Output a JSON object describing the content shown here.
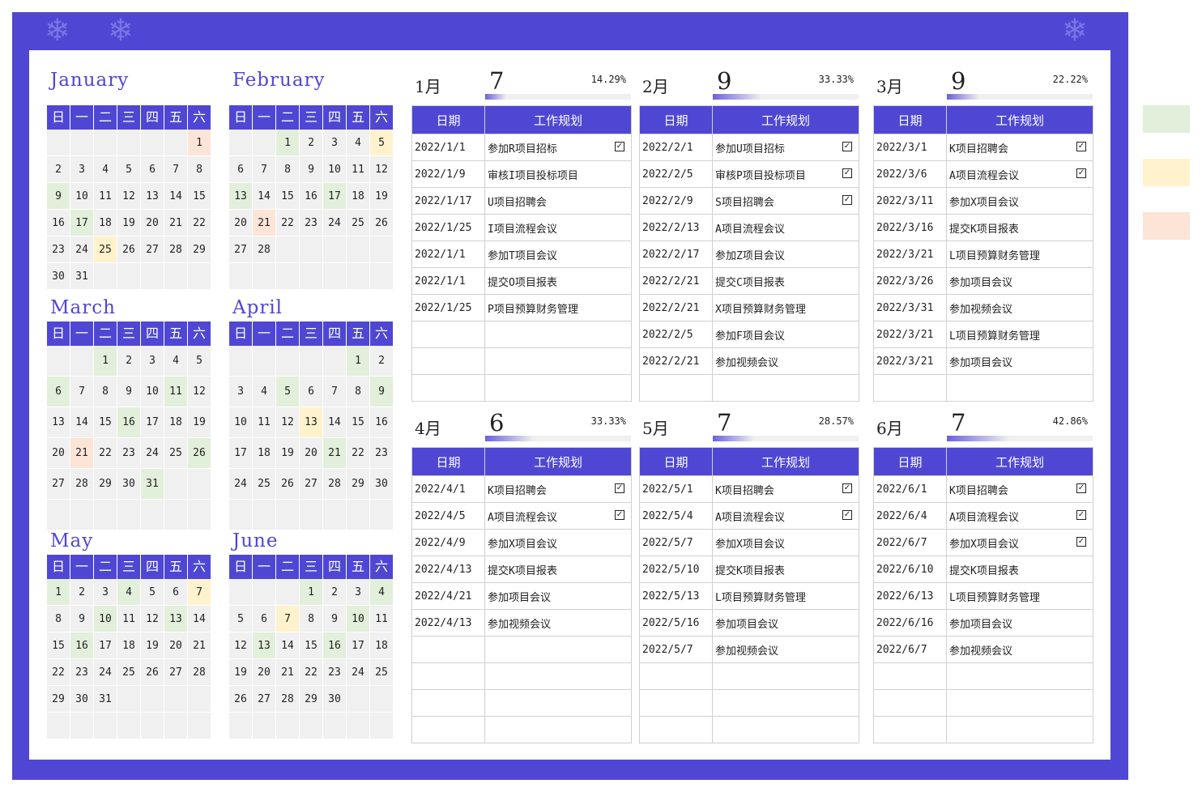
{
  "weekday_labels": [
    "日",
    "一",
    "二",
    "三",
    "四",
    "五",
    "六"
  ],
  "plan_headers": {
    "date": "日期",
    "task": "工作规划"
  },
  "colors": {
    "accent": "#4f47d4",
    "green": "#e2efda",
    "yellow": "#fff2cc",
    "orange": "#fce4d6"
  },
  "calendars": [
    {
      "name": "January",
      "start": 6,
      "days": 31,
      "marks": {
        "1": "o",
        "9": "g",
        "17": "g",
        "25": "y"
      }
    },
    {
      "name": "February",
      "start": 2,
      "days": 28,
      "marks": {
        "1": "g",
        "5": "y",
        "13": "g",
        "17": "g",
        "21": "o"
      }
    },
    {
      "name": "March",
      "start": 2,
      "days": 31,
      "marks": {
        "1": "g",
        "6": "g",
        "11": "g",
        "16": "g",
        "21": "o",
        "26": "g",
        "31": "g"
      }
    },
    {
      "name": "April",
      "start": 5,
      "days": 30,
      "marks": {
        "1": "g",
        "5": "g",
        "9": "g",
        "13": "y",
        "21": "g"
      }
    },
    {
      "name": "May",
      "start": 0,
      "days": 31,
      "marks": {
        "1": "g",
        "4": "g",
        "7": "y",
        "10": "g",
        "13": "g",
        "16": "g"
      }
    },
    {
      "name": "June",
      "start": 3,
      "days": 30,
      "marks": {
        "1": "g",
        "4": "g",
        "7": "y",
        "10": "g",
        "13": "g",
        "16": "g"
      }
    }
  ],
  "plans": [
    {
      "title": "1月",
      "count": "7",
      "percent": "14.29%",
      "progress": 0.1429,
      "rows": [
        {
          "date": "2022/1/1",
          "task": "参加R项目招标",
          "done": true
        },
        {
          "date": "2022/1/9",
          "task": "审核I项目投标项目",
          "done": false
        },
        {
          "date": "2022/1/17",
          "task": "U项目招聘会",
          "done": false
        },
        {
          "date": "2022/1/25",
          "task": "I项目流程会议",
          "done": false
        },
        {
          "date": "2022/1/1",
          "task": "参加T项目会议",
          "done": false
        },
        {
          "date": "2022/1/1",
          "task": "提交O项目报表",
          "done": false
        },
        {
          "date": "2022/1/25",
          "task": "P项目预算财务管理",
          "done": false
        }
      ]
    },
    {
      "title": "2月",
      "count": "9",
      "percent": "33.33%",
      "progress": 0.3333,
      "rows": [
        {
          "date": "2022/2/1",
          "task": "参加U项目招标",
          "done": true
        },
        {
          "date": "2022/2/5",
          "task": "审核P项目投标项目",
          "done": true
        },
        {
          "date": "2022/2/9",
          "task": "S项目招聘会",
          "done": true
        },
        {
          "date": "2022/2/13",
          "task": "A项目流程会议",
          "done": false
        },
        {
          "date": "2022/2/17",
          "task": "参加Z项目会议",
          "done": false
        },
        {
          "date": "2022/2/21",
          "task": "提交C项目报表",
          "done": false
        },
        {
          "date": "2022/2/21",
          "task": "X项目预算财务管理",
          "done": false
        },
        {
          "date": "2022/2/5",
          "task": "参加F项目会议",
          "done": false
        },
        {
          "date": "2022/2/21",
          "task": "参加视频会议",
          "done": false
        }
      ]
    },
    {
      "title": "3月",
      "count": "9",
      "percent": "22.22%",
      "progress": 0.2222,
      "rows": [
        {
          "date": "2022/3/1",
          "task": "K项目招聘会",
          "done": true
        },
        {
          "date": "2022/3/6",
          "task": "A项目流程会议",
          "done": true
        },
        {
          "date": "2022/3/11",
          "task": "参加X项目会议",
          "done": false
        },
        {
          "date": "2022/3/16",
          "task": "提交K项目报表",
          "done": false
        },
        {
          "date": "2022/3/21",
          "task": "L项目预算财务管理",
          "done": false
        },
        {
          "date": "2022/3/26",
          "task": "参加项目会议",
          "done": false
        },
        {
          "date": "2022/3/31",
          "task": "参加视频会议",
          "done": false
        },
        {
          "date": "2022/3/21",
          "task": "L项目预算财务管理",
          "done": false
        },
        {
          "date": "2022/3/21",
          "task": "参加项目会议",
          "done": false
        }
      ]
    },
    {
      "title": "4月",
      "count": "6",
      "percent": "33.33%",
      "progress": 0.3333,
      "rows": [
        {
          "date": "2022/4/1",
          "task": "K项目招聘会",
          "done": true
        },
        {
          "date": "2022/4/5",
          "task": "A项目流程会议",
          "done": true
        },
        {
          "date": "2022/4/9",
          "task": "参加X项目会议",
          "done": false
        },
        {
          "date": "2022/4/13",
          "task": "提交K项目报表",
          "done": false
        },
        {
          "date": "2022/4/21",
          "task": "参加项目会议",
          "done": false
        },
        {
          "date": "2022/4/13",
          "task": "参加视频会议",
          "done": false
        }
      ]
    },
    {
      "title": "5月",
      "count": "7",
      "percent": "28.57%",
      "progress": 0.2857,
      "rows": [
        {
          "date": "2022/5/1",
          "task": "K项目招聘会",
          "done": true
        },
        {
          "date": "2022/5/4",
          "task": "A项目流程会议",
          "done": true
        },
        {
          "date": "2022/5/7",
          "task": "参加X项目会议",
          "done": false
        },
        {
          "date": "2022/5/10",
          "task": "提交K项目报表",
          "done": false
        },
        {
          "date": "2022/5/13",
          "task": "L项目预算财务管理",
          "done": false
        },
        {
          "date": "2022/5/16",
          "task": "参加项目会议",
          "done": false
        },
        {
          "date": "2022/5/7",
          "task": "参加视频会议",
          "done": false
        }
      ]
    },
    {
      "title": "6月",
      "count": "7",
      "percent": "42.86%",
      "progress": 0.4286,
      "rows": [
        {
          "date": "2022/6/1",
          "task": "K项目招聘会",
          "done": true
        },
        {
          "date": "2022/6/4",
          "task": "A项目流程会议",
          "done": true
        },
        {
          "date": "2022/6/7",
          "task": "参加X项目会议",
          "done": true
        },
        {
          "date": "2022/6/10",
          "task": "提交K项目报表",
          "done": false
        },
        {
          "date": "2022/6/13",
          "task": "L项目预算财务管理",
          "done": false
        },
        {
          "date": "2022/6/16",
          "task": "参加项目会议",
          "done": false
        },
        {
          "date": "2022/6/7",
          "task": "参加视频会议",
          "done": false
        }
      ]
    }
  ],
  "legend": [
    {
      "color": "#e2efda"
    },
    {
      "color": "#fff2cc"
    },
    {
      "color": "#fce4d6"
    }
  ]
}
